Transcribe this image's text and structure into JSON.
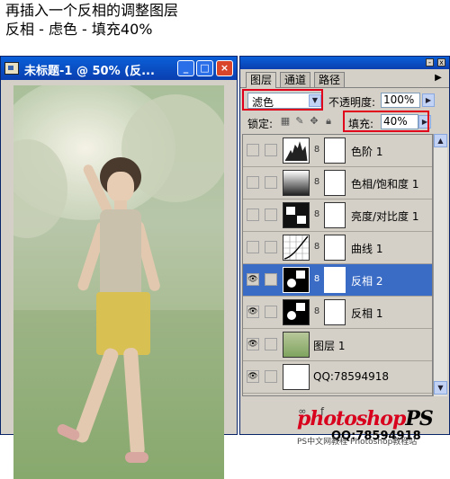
{
  "instructions": {
    "line1": "再插入一个反相的调整图层",
    "line2": "反相 - 虑色 - 填充40%"
  },
  "document": {
    "title": "未标题-1 @ 50% (反..."
  },
  "layers_panel": {
    "tabs": [
      "图层",
      "通道",
      "路径"
    ],
    "blend_mode": "滤色",
    "opacity_label": "不透明度:",
    "opacity_value": "100%",
    "lock_label": "锁定:",
    "fill_label": "填充:",
    "fill_value": "40%",
    "layers": [
      {
        "name": "色阶 1",
        "visible": false,
        "selected": false,
        "thumb": "levels-icon"
      },
      {
        "name": "色相/饱和度 1",
        "visible": false,
        "selected": false,
        "thumb": "hue-saturation-icon"
      },
      {
        "name": "亮度/对比度 1",
        "visible": false,
        "selected": false,
        "thumb": "brightness-contrast-icon"
      },
      {
        "name": "曲线 1",
        "visible": false,
        "selected": false,
        "thumb": "curves-icon"
      },
      {
        "name": "反相 2",
        "visible": true,
        "selected": true,
        "thumb": "invert-icon"
      },
      {
        "name": "反相 1",
        "visible": true,
        "selected": false,
        "thumb": "invert-icon"
      },
      {
        "name": "图层 1",
        "visible": true,
        "selected": false,
        "thumb": "photo-thumb"
      },
      {
        "name": "QQ:78594918",
        "visible": true,
        "selected": false,
        "thumb": "white-thumb"
      }
    ]
  },
  "watermark": {
    "brand_a": "photoshop",
    "brand_b": "PS",
    "subtitle": "PS中文网教程 Photoshop教程站",
    "qq": "QQ:78594918"
  },
  "colors": {
    "selection": "#3a6bc5",
    "highlight": "#e0001b",
    "titlebar": "#0a3fb0"
  }
}
